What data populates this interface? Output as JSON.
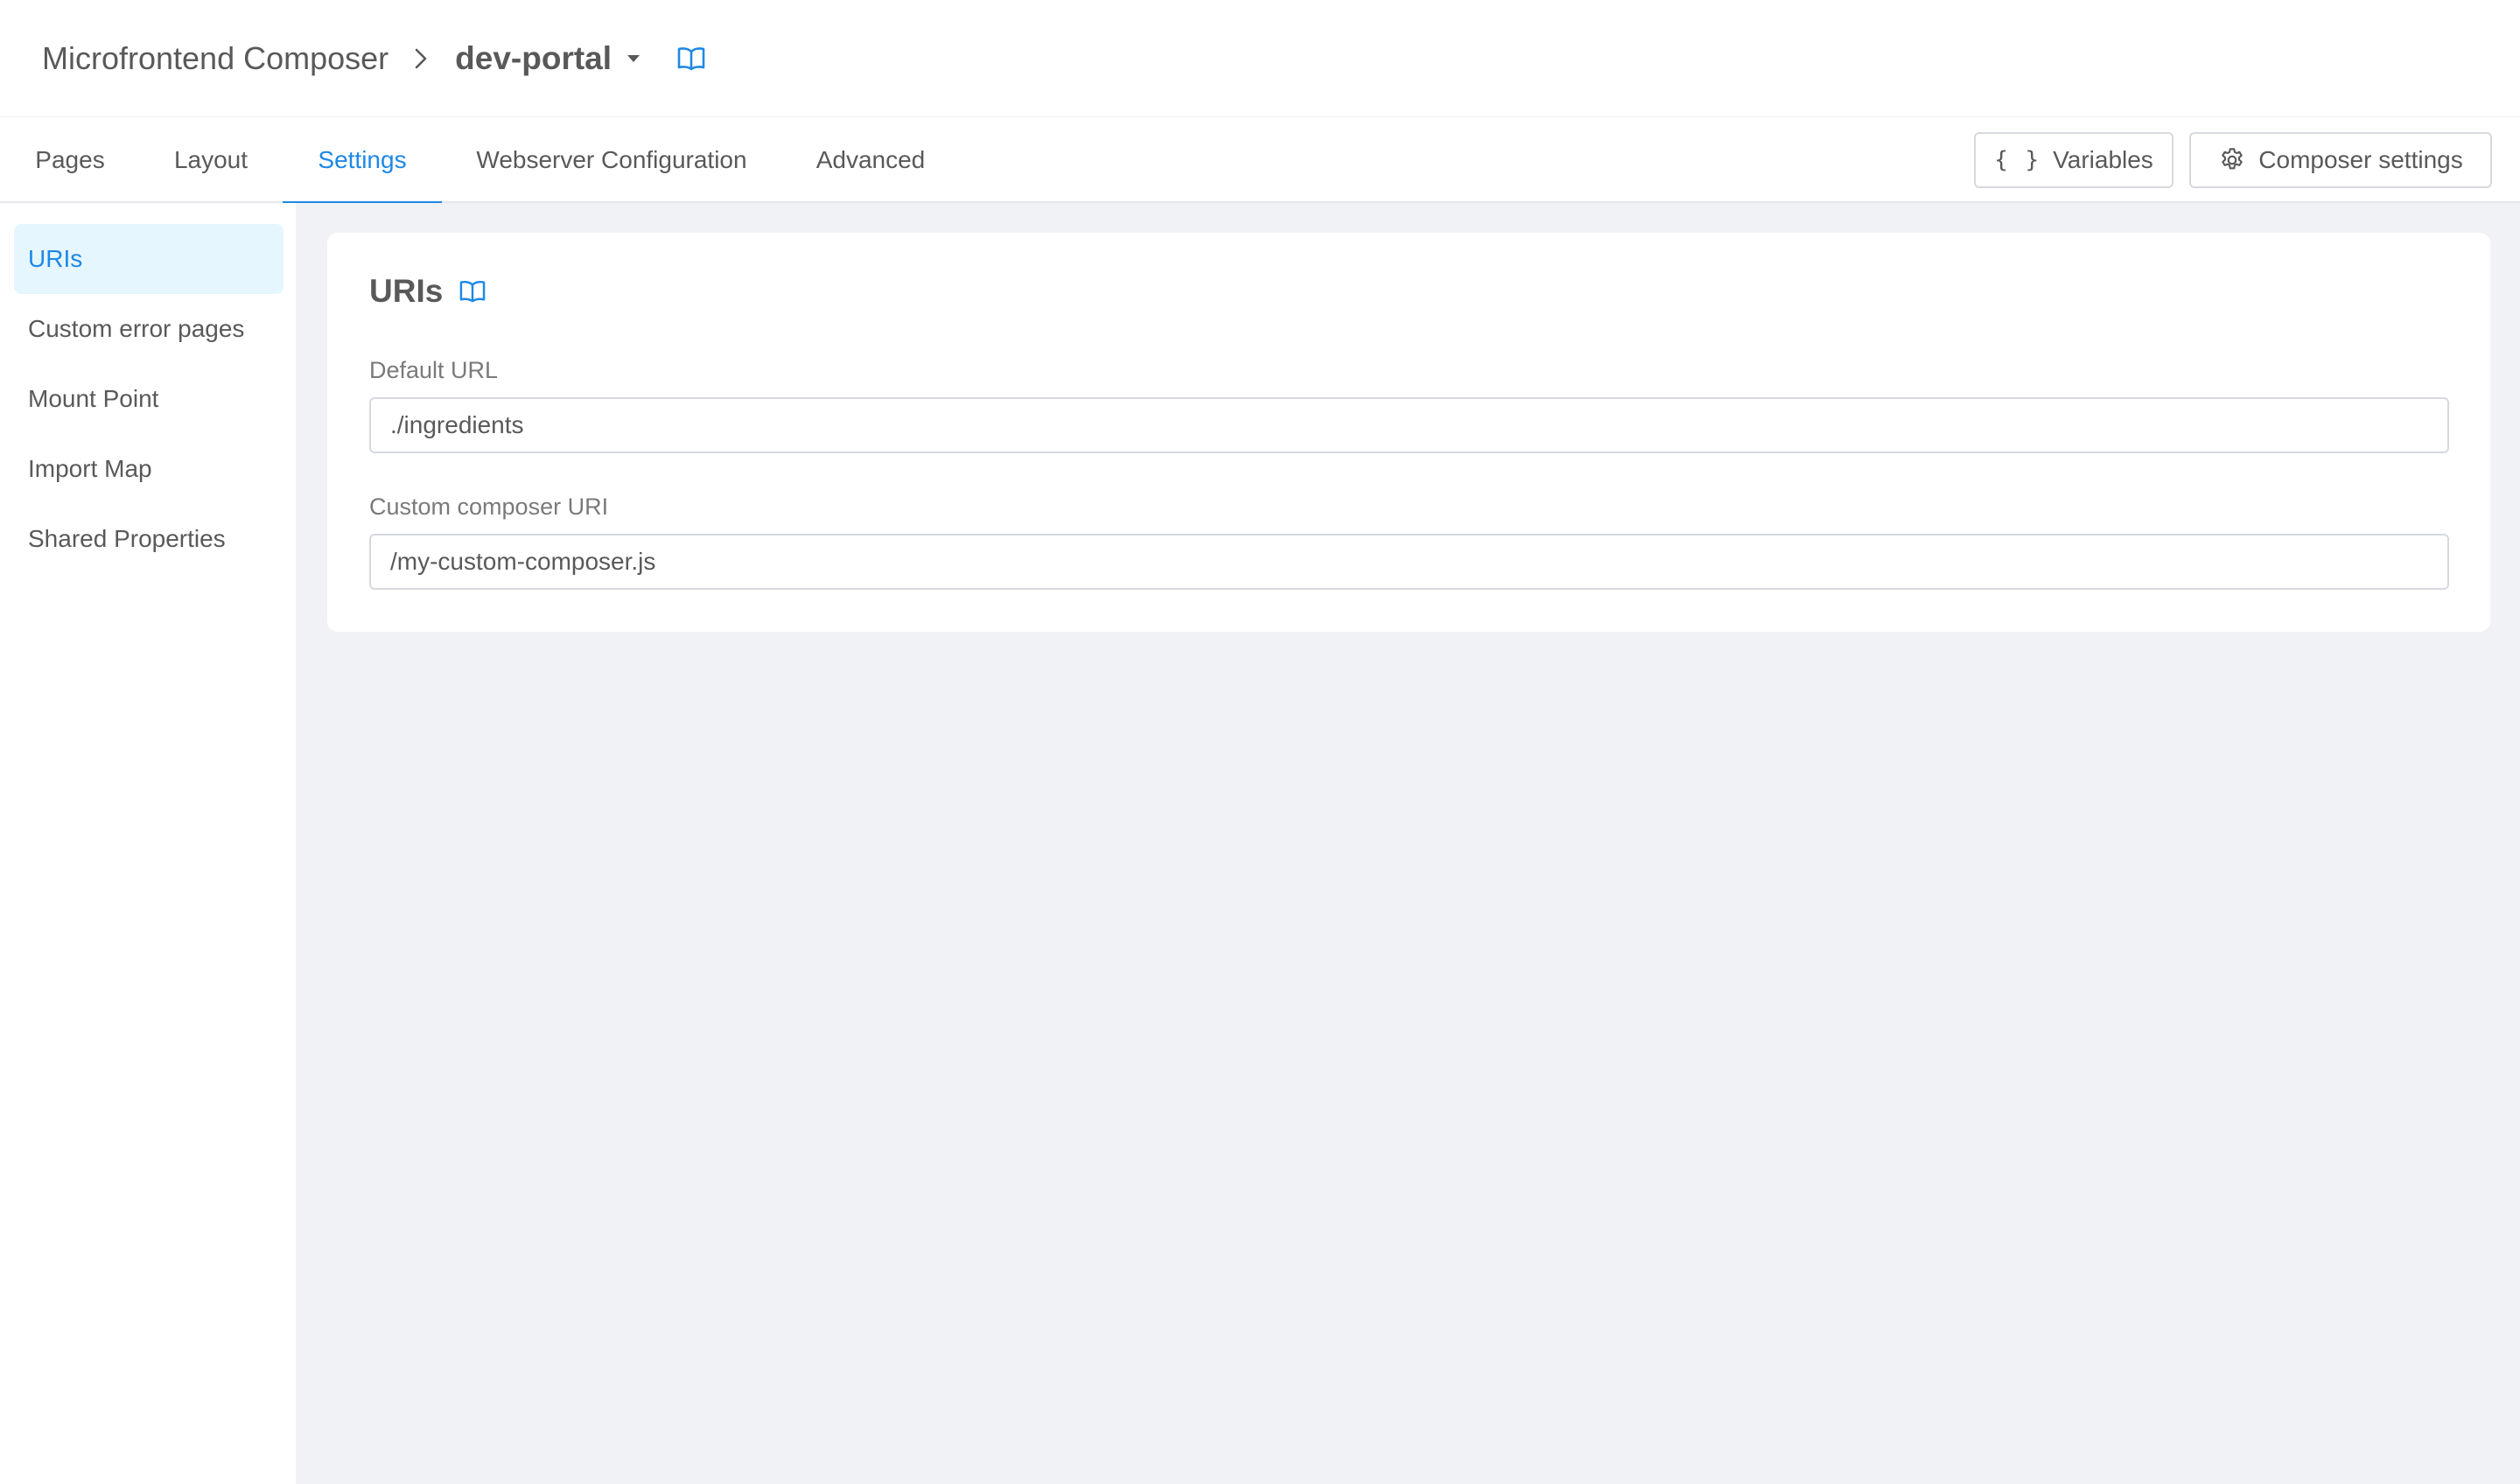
{
  "header": {
    "app_title": "Microfrontend Composer",
    "project_name": "dev-portal",
    "separator_icon": "chevron-right-icon",
    "dropdown_icon": "caret-down-icon",
    "docs_icon": "book-open-icon"
  },
  "tabs": [
    {
      "label": "Pages",
      "active": false
    },
    {
      "label": "Layout",
      "active": false
    },
    {
      "label": "Settings",
      "active": true
    },
    {
      "label": "Webserver Configuration",
      "active": false
    },
    {
      "label": "Advanced",
      "active": false
    }
  ],
  "toolbar": {
    "variables_label": "Variables",
    "variables_icon_glyph": "{ }",
    "composer_settings_label": "Composer settings",
    "composer_settings_icon": "gear-icon"
  },
  "sidebar": {
    "items": [
      {
        "label": "URIs",
        "active": true
      },
      {
        "label": "Custom error pages",
        "active": false
      },
      {
        "label": "Mount Point",
        "active": false
      },
      {
        "label": "Import Map",
        "active": false
      },
      {
        "label": "Shared Properties",
        "active": false
      }
    ]
  },
  "card": {
    "title": "URIs",
    "fields": [
      {
        "label": "Default URL",
        "value": "./ingredients"
      },
      {
        "label": "Custom composer URI",
        "value": "/my-custom-composer.js"
      }
    ]
  },
  "colors": {
    "accent": "#1e88e5",
    "active_item_bg": "#e6f6fe",
    "content_bg": "#f0f2f5",
    "text": "#595959"
  }
}
